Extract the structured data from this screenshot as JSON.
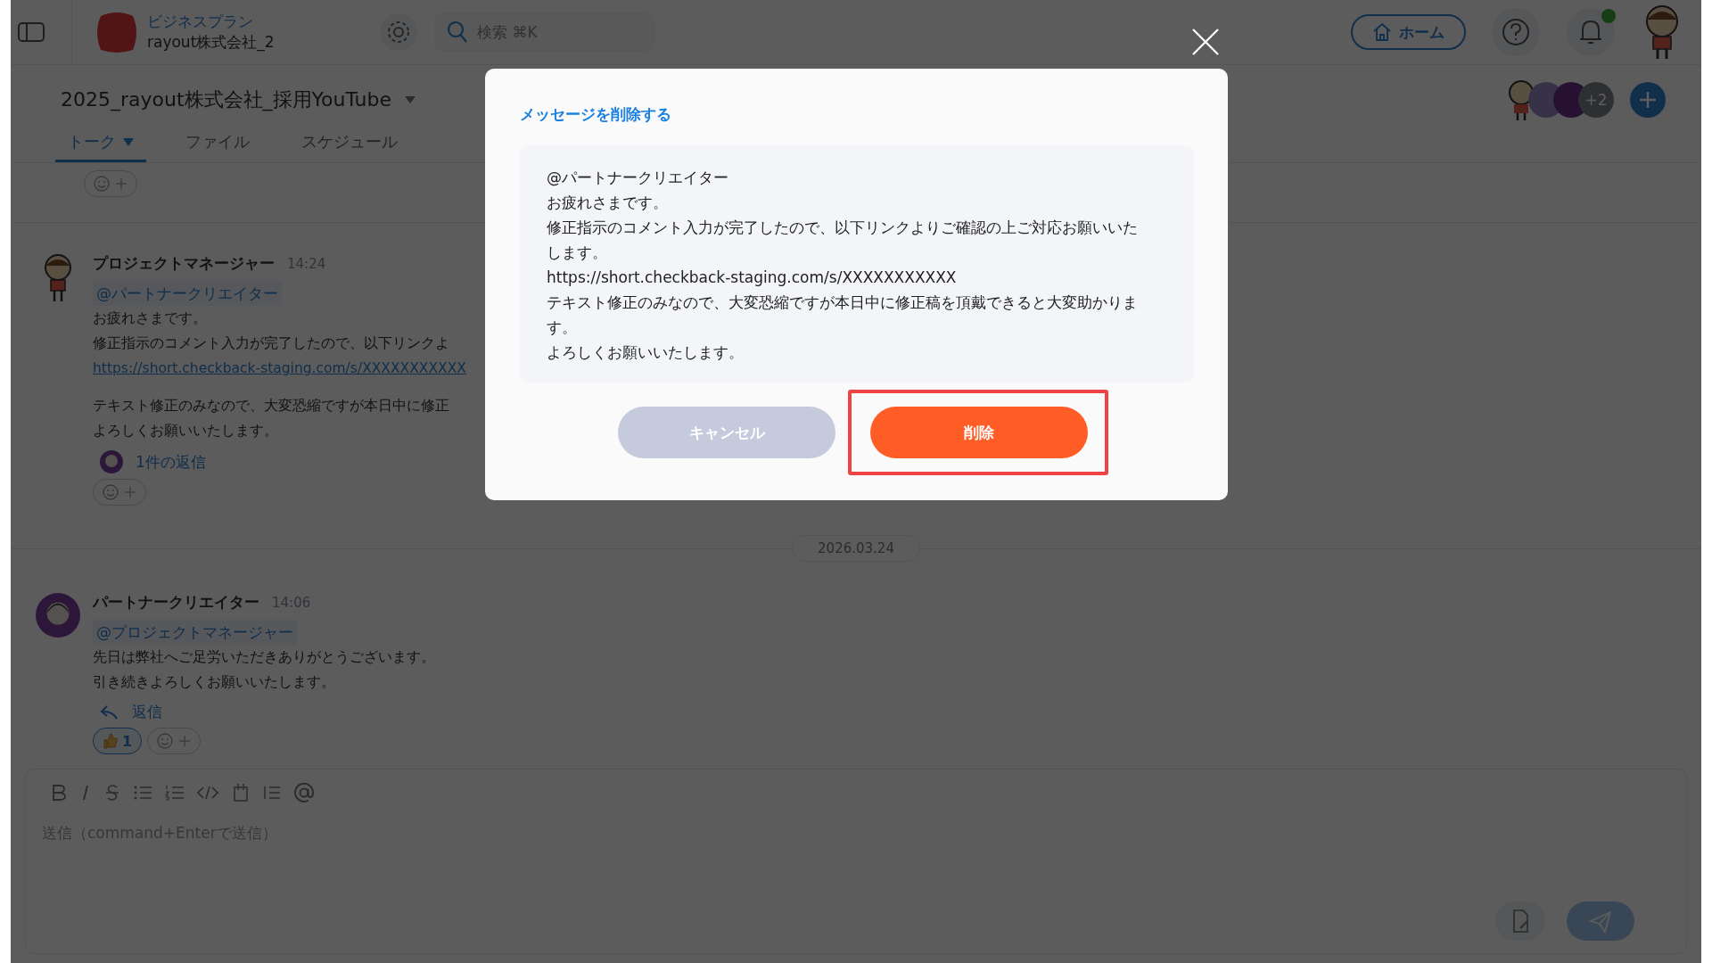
{
  "workspace": {
    "plan": "ビジネスプラン",
    "name": "rayout株式会社_2"
  },
  "search": {
    "placeholder": "検索 ⌘K"
  },
  "home_button": "ホーム",
  "notifications": {
    "unread": true
  },
  "channel": {
    "title": "2025_rayout株式会社_採用YouTube"
  },
  "tabs": [
    {
      "label": "トーク",
      "selected": true,
      "dropdown": true
    },
    {
      "label": "ファイル",
      "selected": false,
      "dropdown": false
    },
    {
      "label": "スケジュール",
      "selected": false,
      "dropdown": false
    }
  ],
  "members": {
    "more": "+2"
  },
  "feed": [
    {
      "kind": "reactions"
    },
    {
      "kind": "message",
      "author": "プロジェクトマネージャー",
      "time": "14:24",
      "lines": [
        {
          "kind": "mention",
          "text": "@パートナークリエイター"
        },
        {
          "kind": "text",
          "text": "お疲れさまです。"
        },
        {
          "kind": "text",
          "text": "修正指示のコメント入力が完了したので、以下リンクよ"
        },
        {
          "kind": "link",
          "text": "https://short.checkback-staging.com/s/XXXXXXXXXXX"
        },
        {
          "kind": "spacer"
        },
        {
          "kind": "text",
          "text": "テキスト修正のみなので、大変恐縮ですが本日中に修正"
        },
        {
          "kind": "text",
          "text": "よろしくお願いいたします。"
        }
      ],
      "reply": {
        "kind": "thread",
        "label": "1件の返信"
      }
    },
    {
      "kind": "date",
      "label": "2026.03.24"
    },
    {
      "kind": "message",
      "author": "パートナークリエイター",
      "time": "14:06",
      "lines": [
        {
          "kind": "mention",
          "text": "@プロジェクトマネージャー"
        },
        {
          "kind": "text",
          "text": "先日は弊社へご足労いただきありがとうございます。"
        },
        {
          "kind": "text",
          "text": "引き続きよろしくお願いいたします。"
        }
      ],
      "reply": {
        "kind": "reply",
        "label": "返信"
      },
      "reactions": [
        {
          "count": "1",
          "selected": true
        }
      ]
    }
  ],
  "composer": {
    "placeholder": "送信（command+Enterで送信）"
  },
  "modal": {
    "title": "メッセージを削除する",
    "quote": [
      "@パートナークリエイター",
      "お疲れさまです。",
      "修正指示のコメント入力が完了したので、以下リンクよりご確認の上ご対応お願いいたします。",
      "https://short.checkback-staging.com/s/XXXXXXXXXXX",
      "テキスト修正のみなので、大変恐縮ですが本日中に修正稿を頂戴できると大変助かります。",
      "よろしくお願いいたします。"
    ],
    "cancel": "キャンセル",
    "confirm": "削除",
    "confirm_highlighted": true
  }
}
